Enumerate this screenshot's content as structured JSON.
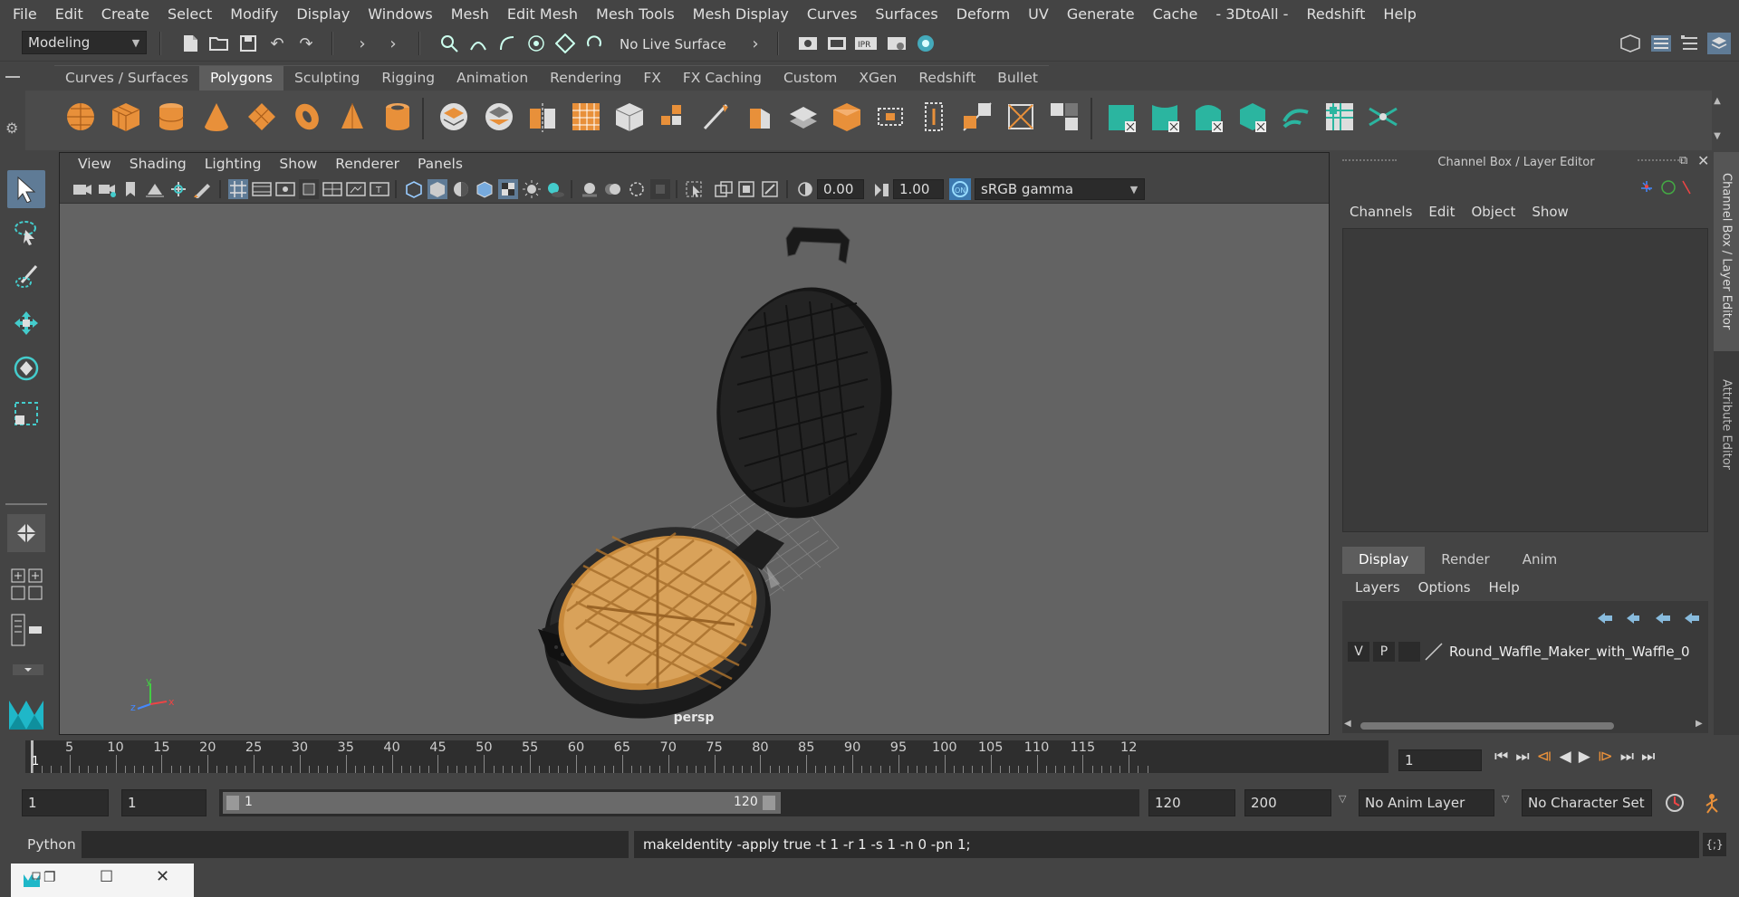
{
  "menubar": {
    "items": [
      "File",
      "Edit",
      "Create",
      "Select",
      "Modify",
      "Display",
      "Windows",
      "Mesh",
      "Edit Mesh",
      "Mesh Tools",
      "Mesh Display",
      "Curves",
      "Surfaces",
      "Deform",
      "UV",
      "Generate",
      "Cache",
      "- 3DtoAll -",
      "Redshift",
      "Help"
    ]
  },
  "statusline": {
    "mode": "Modeling",
    "live_surface": "No Live Surface"
  },
  "shelf": {
    "tabs": [
      "Curves / Surfaces",
      "Polygons",
      "Sculpting",
      "Rigging",
      "Animation",
      "Rendering",
      "FX",
      "FX Caching",
      "Custom",
      "XGen",
      "Redshift",
      "Bullet"
    ],
    "active_tab": "Polygons"
  },
  "viewport": {
    "menu": [
      "View",
      "Shading",
      "Lighting",
      "Show",
      "Renderer",
      "Panels"
    ],
    "exposure": "0.00",
    "gamma": "1.00",
    "color_space": "sRGB gamma",
    "camera": "persp",
    "axis_x": "x",
    "axis_y": "y",
    "axis_z": "z"
  },
  "channelbox": {
    "title": "Channel Box / Layer Editor",
    "menu": [
      "Channels",
      "Edit",
      "Object",
      "Show"
    ]
  },
  "layer_editor": {
    "tabs": [
      "Display",
      "Render",
      "Anim"
    ],
    "active_tab": "Display",
    "menu": [
      "Layers",
      "Options",
      "Help"
    ],
    "layer": {
      "visible": "V",
      "playback": "P",
      "name": "Round_Waffle_Maker_with_Waffle_0"
    }
  },
  "sidetabs": {
    "channel": "Channel Box / Layer Editor",
    "attribute": "Attribute Editor"
  },
  "timeline": {
    "ticks": [
      "5",
      "10",
      "15",
      "20",
      "25",
      "30",
      "35",
      "40",
      "45",
      "50",
      "55",
      "60",
      "65",
      "70",
      "75",
      "80",
      "85",
      "90",
      "95",
      "100",
      "105",
      "110",
      "115",
      "12"
    ],
    "current_label": "1",
    "current_frame": "1"
  },
  "range": {
    "start": "1",
    "playback_start": "1",
    "slider_start": "1",
    "slider_end": "120",
    "playback_end": "120",
    "end": "200",
    "anim_layer": "No Anim Layer",
    "char_set": "No Character Set"
  },
  "cmdline": {
    "language": "Python",
    "output": "makeIdentity -apply true -t 1 -r 1 -s 1 -n 0 -pn 1;"
  },
  "colors": {
    "accent": "#5f7b96",
    "shelf_orange": "#e8903a",
    "shelf_teal": "#2bb5a0"
  }
}
